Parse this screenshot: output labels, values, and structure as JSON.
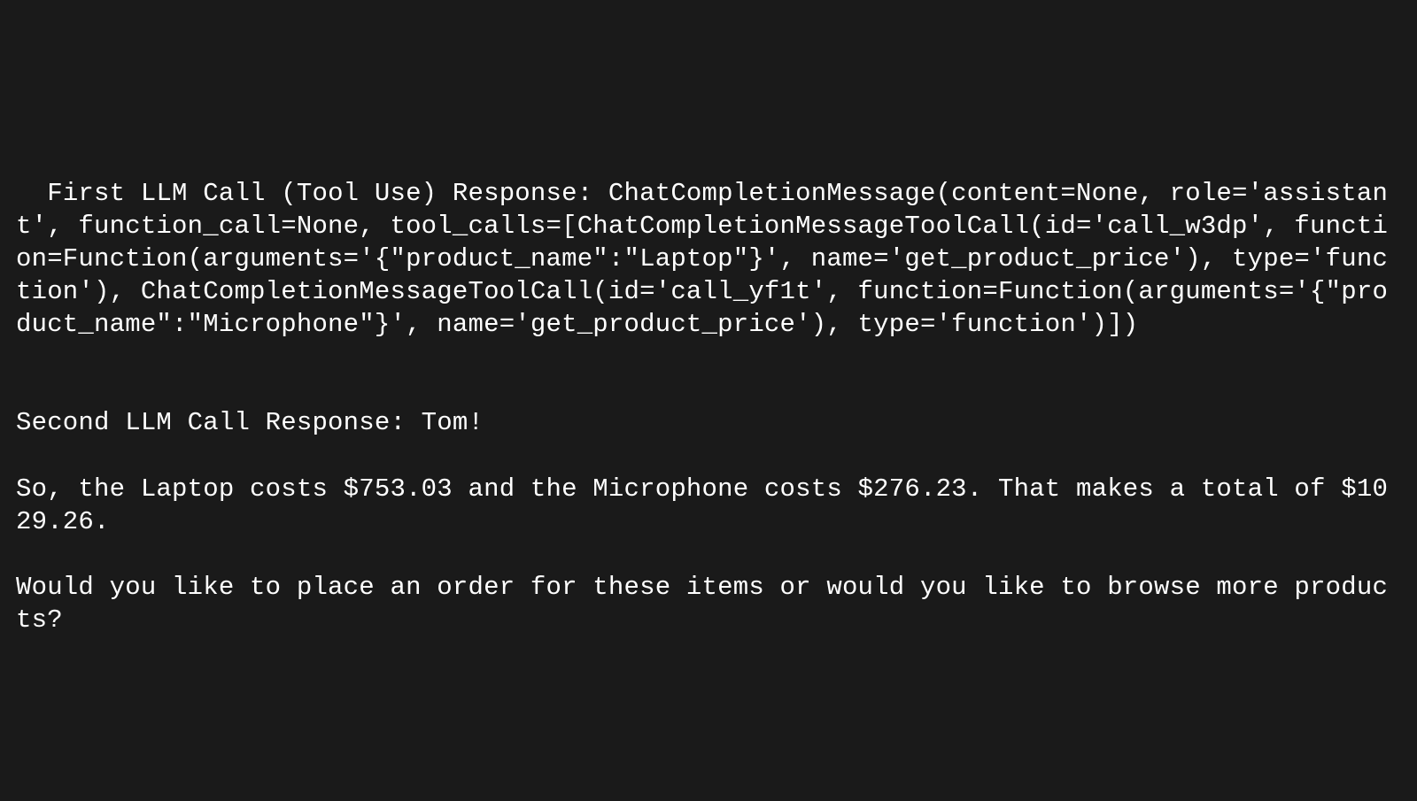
{
  "terminal": {
    "lines": [
      "First LLM Call (Tool Use) Response: ChatCompletionMessage(content=None, role='assistant', function_call=None, tool_calls=[ChatCompletionMessageToolCall(id='call_w3dp', function=Function(arguments='{\"product_name\":\"Laptop\"}', name='get_product_price'), type='function'), ChatCompletionMessageToolCall(id='call_yf1t', function=Function(arguments='{\"product_name\":\"Microphone\"}', name='get_product_price'), type='function')])",
      "",
      "",
      "Second LLM Call Response: Tom!",
      "",
      "So, the Laptop costs $753.03 and the Microphone costs $276.23. That makes a total of $1029.26.",
      "",
      "Would you like to place an order for these items or would you like to browse more products?"
    ]
  }
}
